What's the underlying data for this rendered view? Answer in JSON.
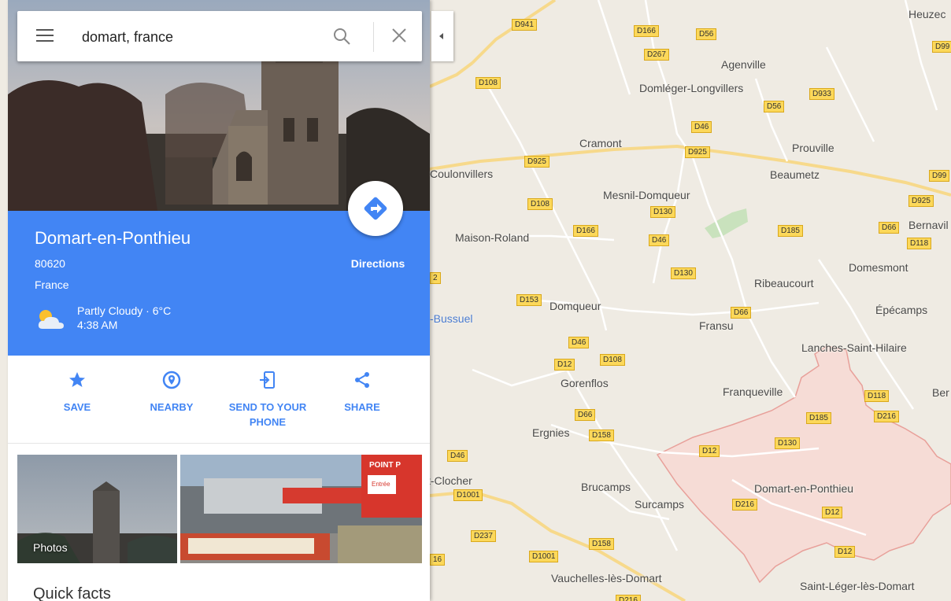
{
  "search": {
    "value": "domart, france"
  },
  "place": {
    "title": "Domart-en-Ponthieu",
    "postcode": "80620",
    "country": "France",
    "weather_line1": "Partly Cloudy · 6°C",
    "weather_line2": "4:38 AM",
    "directions_label": "Directions"
  },
  "actions": [
    {
      "label": "SAVE",
      "icon": "star-icon"
    },
    {
      "label": "NEARBY",
      "icon": "nearby-pin-icon"
    },
    {
      "label": "SEND TO YOUR PHONE",
      "icon": "send-to-phone-icon"
    },
    {
      "label": "SHARE",
      "icon": "share-icon"
    }
  ],
  "photos": {
    "label": "Photos",
    "store_sign_small": "Entrée",
    "store_sign_brand": "POINT P"
  },
  "quick_facts_heading": "Quick facts",
  "colors": {
    "accent_blue": "#4285f4",
    "map_background": "#efebe3",
    "road_label": "#fcd85a",
    "commune_boundary": "#e8a09a",
    "commune_fill": "#f6dcd6",
    "park_green": "#c9e2bd"
  },
  "map": {
    "places": [
      {
        "name": "Heuzec",
        "cls": ""
      },
      {
        "name": "Agenville",
        "cls": ""
      },
      {
        "name": "Domléger-Longvillers",
        "cls": ""
      },
      {
        "name": "Cramont",
        "cls": ""
      },
      {
        "name": "Prouville",
        "cls": ""
      },
      {
        "name": "Beaumetz",
        "cls": ""
      },
      {
        "name": "Coulonvillers",
        "cls": ""
      },
      {
        "name": "Mesnil-Domqueur",
        "cls": ""
      },
      {
        "name": "Maison-Roland",
        "cls": ""
      },
      {
        "name": "Bernavil",
        "cls": ""
      },
      {
        "name": "Domesmont",
        "cls": ""
      },
      {
        "name": "Ribeaucourt",
        "cls": ""
      },
      {
        "name": "Domqueur",
        "cls": ""
      },
      {
        "name": "-Bussuel",
        "cls": "blue"
      },
      {
        "name": "Fransu",
        "cls": ""
      },
      {
        "name": "Épécamps",
        "cls": ""
      },
      {
        "name": "Lanches-Saint-Hilaire",
        "cls": ""
      },
      {
        "name": "Gorenflos",
        "cls": ""
      },
      {
        "name": "Franqueville",
        "cls": ""
      },
      {
        "name": "Ber",
        "cls": ""
      },
      {
        "name": "Ergnies",
        "cls": ""
      },
      {
        "name": "t-Clocher",
        "cls": ""
      },
      {
        "name": "Brucamps",
        "cls": ""
      },
      {
        "name": "Surcamps",
        "cls": ""
      },
      {
        "name": "Domart-en-Ponthieu",
        "cls": ""
      },
      {
        "name": "Vauchelles-lès-Domart",
        "cls": ""
      },
      {
        "name": "Saint-Léger-lès-Domart",
        "cls": ""
      }
    ],
    "roads": [
      "D941",
      "D166",
      "D56",
      "D267",
      "D99",
      "D108",
      "D933",
      "D56",
      "D46",
      "D925",
      "D925",
      "D99",
      "D108",
      "D130",
      "D925",
      "D166",
      "D46",
      "D185",
      "D66",
      "D118",
      "D130",
      "D153",
      "D66",
      "D46",
      "D12",
      "D108",
      "D118",
      "D216",
      "D66",
      "D185",
      "D158",
      "D12",
      "D130",
      "D46",
      "D1001",
      "D216",
      "D12",
      "D237",
      "D158",
      "D1001",
      "D12",
      "D216",
      "2",
      "16"
    ]
  }
}
